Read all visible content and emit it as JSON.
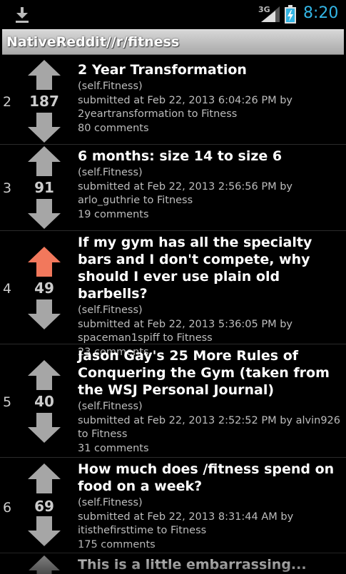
{
  "status_bar": {
    "time": "8:20",
    "network": "3G",
    "icons": [
      "download-icon",
      "signal-icon",
      "battery-charging-icon"
    ],
    "accent_color": "#33b5e5"
  },
  "title_bar": {
    "title": "NativeReddit//r/fitness"
  },
  "colors": {
    "upvoted_arrow": "#f2785c",
    "neutral_arrow": "#a6a6a6"
  },
  "posts": [
    {
      "rank": "2",
      "score": "187",
      "upvoted": false,
      "title": "2 Year Transformation",
      "domain": "(self.Fitness)",
      "meta": "submitted at Feb 22, 2013 6:04:26 PM by 2yeartransformation to Fitness",
      "comments": "80 comments"
    },
    {
      "rank": "3",
      "score": "91",
      "upvoted": false,
      "title": "6 months: size 14 to size 6",
      "domain": "(self.Fitness)",
      "meta": "submitted at Feb 22, 2013 2:56:56 PM by arlo_guthrie to Fitness",
      "comments": "19 comments"
    },
    {
      "rank": "4",
      "score": "49",
      "upvoted": true,
      "title": "If my gym has all the specialty bars and I don't compete, why should I ever use plain old barbells?",
      "domain": "(self.Fitness)",
      "meta": "submitted at Feb 22, 2013 5:36:05 PM by spaceman1spiff to Fitness",
      "comments": "23 comments"
    },
    {
      "rank": "5",
      "score": "40",
      "upvoted": false,
      "title": "Jason Gay's 25 More Rules of Conquering the Gym (taken from the WSJ Personal Journal)",
      "domain": "(self.Fitness)",
      "meta": "submitted at Feb 22, 2013 2:52:52 PM by alvin926 to Fitness",
      "comments": "31 comments"
    },
    {
      "rank": "6",
      "score": "69",
      "upvoted": false,
      "title": "How much does /fitness spend on food on a week?",
      "domain": "(self.Fitness)",
      "meta": "submitted at Feb 22, 2013 8:31:44 AM by itisthefirsttime to Fitness",
      "comments": "175 comments"
    }
  ],
  "partial_post": {
    "title": "This is a little embarrassing..."
  }
}
